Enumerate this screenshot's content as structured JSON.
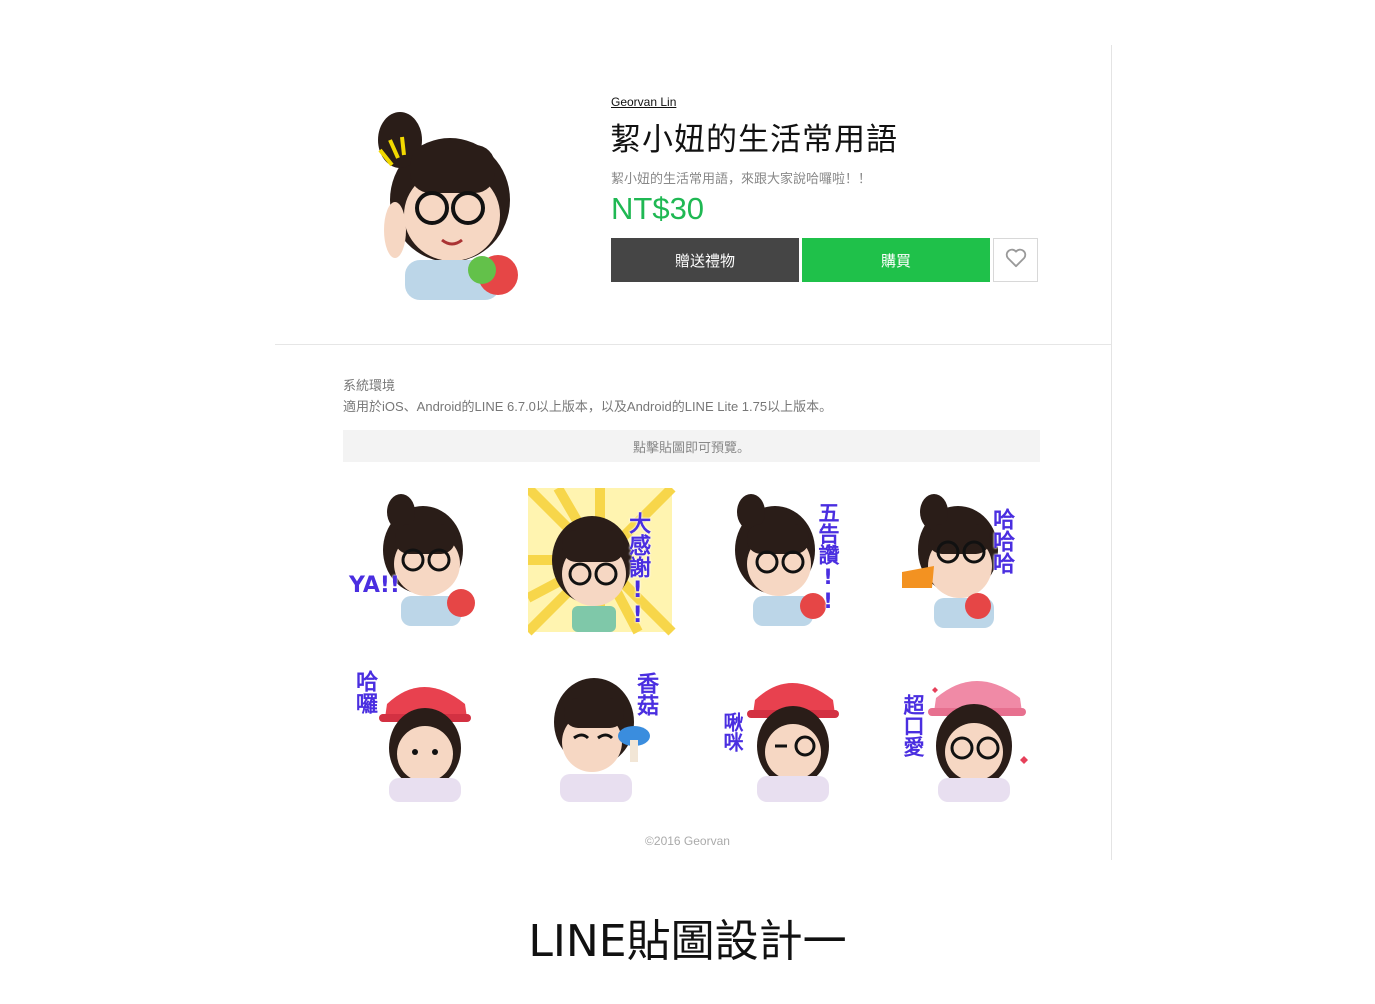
{
  "product": {
    "author": "Georvan Lin",
    "title": "絜小妞的生活常用語",
    "description": "絜小妞的生活常用語，來跟大家說哈囉啦！！",
    "price": "NT$30",
    "gift_label": "贈送禮物",
    "buy_label": "購買",
    "favorite_icon": "heart-icon"
  },
  "info": {
    "env_label": "系統環境",
    "env_text": "適用於iOS、Android的LINE 6.7.0以上版本，以及Android的LINE Lite 1.75以上版本。",
    "preview_hint": "點擊貼圖即可預覽。"
  },
  "stickers": [
    {
      "caption": "YA!!"
    },
    {
      "caption": "大感謝!!"
    },
    {
      "caption": "五告讚!!"
    },
    {
      "caption": "哈哈哈"
    },
    {
      "caption": "哈囉"
    },
    {
      "caption": "香菇"
    },
    {
      "caption": "啾咪"
    },
    {
      "caption": "超口愛"
    }
  ],
  "footer": {
    "copyright": "©2016 Georvan"
  },
  "caption": "LINE貼圖設計一",
  "colors": {
    "price": "#1fb853",
    "buy": "#1fc14a",
    "gift": "#454545",
    "sticker_text": "#4a2ee0"
  }
}
